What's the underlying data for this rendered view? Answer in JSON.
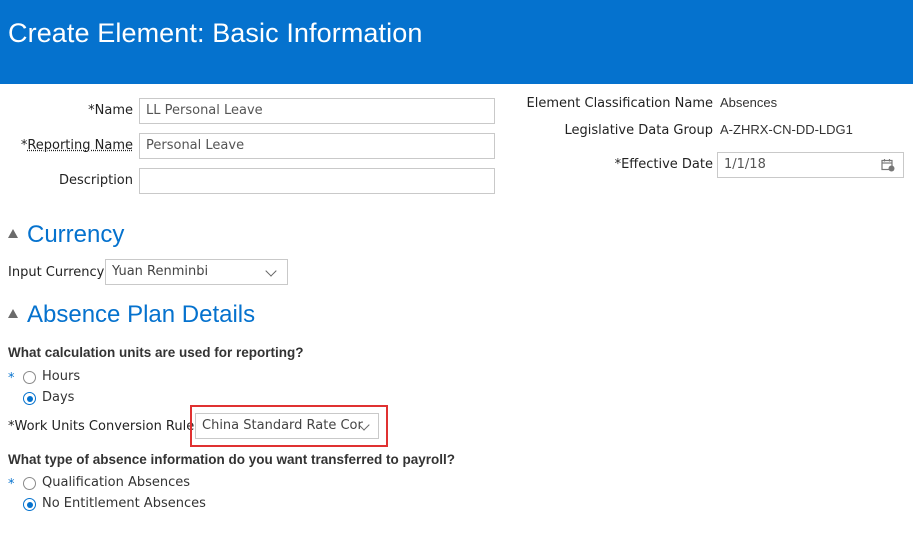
{
  "header": {
    "title": "Create Element: Basic Information"
  },
  "form": {
    "name": {
      "label": "Name",
      "required_mark": "*",
      "value": "LL Personal Leave"
    },
    "reporting_name": {
      "label": "Reporting Name",
      "required_mark": "*",
      "value": "Personal Leave"
    },
    "description": {
      "label": "Description",
      "value": ""
    },
    "element_classification": {
      "label": "Element Classification Name",
      "value": "Absences"
    },
    "legislative_data_group": {
      "label": "Legislative Data Group",
      "value": "A-ZHRX-CN-DD-LDG1"
    },
    "effective_date": {
      "label": "Effective Date",
      "required_mark": "*",
      "value": "1/1/18",
      "icon": "calendar-icon"
    }
  },
  "currency": {
    "title": "Currency",
    "input_currency_label": "Input Currency",
    "input_currency_value": "Yuan Renminbi"
  },
  "absence_plan": {
    "title": "Absence Plan Details",
    "units_question": "What calculation units are used for reporting?",
    "units_options": [
      {
        "label": "Hours",
        "selected": false
      },
      {
        "label": "Days",
        "selected": true
      }
    ],
    "required_mark": "*",
    "conversion_rule_label": "Work Units Conversion Rule",
    "conversion_rule_value": "China Standard Rate Cor",
    "transfer_question": "What type of absence information do you want transferred to payroll?",
    "transfer_options": [
      {
        "label": "Qualification Absences",
        "selected": false
      },
      {
        "label": "No Entitlement Absences",
        "selected": true
      }
    ]
  },
  "colors": {
    "brand": "#0572ce",
    "highlight": "#e03131"
  }
}
